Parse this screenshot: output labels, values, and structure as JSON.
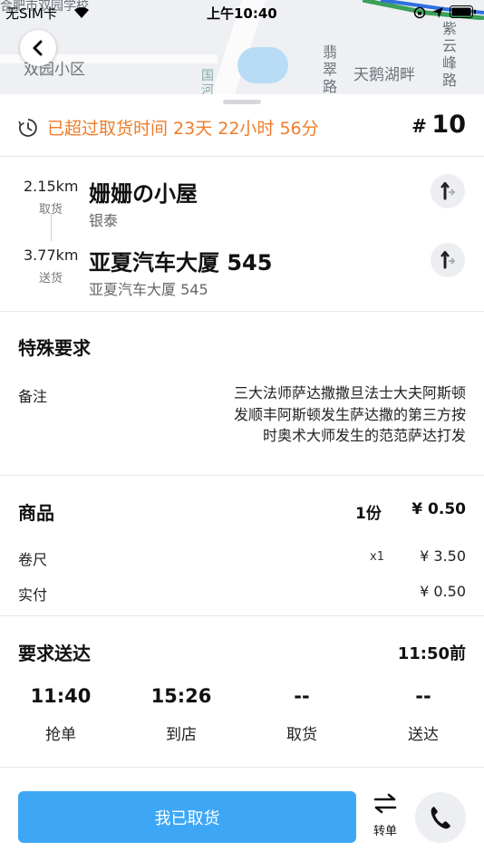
{
  "status_bar": {
    "carrier": "无SIM卡",
    "time": "上午10:40"
  },
  "map": {
    "labels": [
      "合肥市双园学校",
      "双园小区",
      "翡翠路",
      "天鹅湖畔",
      "紫云峰路",
      "国河"
    ]
  },
  "order": {
    "overdue_text": "已超过取货时间 23天 22小时 56分",
    "hash": "#",
    "number": "10",
    "accent_color": "#f07c2a"
  },
  "pickup": {
    "distance": "2.15km",
    "role": "取货",
    "name": "姗姗の小屋",
    "address": "银泰"
  },
  "dropoff": {
    "distance": "3.77km",
    "role": "送货",
    "name": "亚夏汽车大厦 545",
    "address": "亚夏汽车大厦 545"
  },
  "special": {
    "title": "特殊要求",
    "remark_label": "备注",
    "remark_text": "三大法师萨达撒撒旦法士大夫阿斯顿发顺丰阿斯顿发生萨达撒的第三方按时奥术大师发生的范范萨达打发"
  },
  "goods": {
    "title": "商品",
    "count": "1份",
    "total": "¥ 0.50",
    "items": [
      {
        "name": "卷尺",
        "qty": "x1",
        "price": "¥ 3.50"
      }
    ],
    "paid_label": "实付",
    "paid_value": "¥ 0.50"
  },
  "delivery": {
    "title": "要求送达",
    "deadline": "11:50前",
    "timeline": [
      {
        "time": "11:40",
        "label": "抢单"
      },
      {
        "time": "15:26",
        "label": "到店"
      },
      {
        "time": "--",
        "label": "取货"
      },
      {
        "time": "--",
        "label": "送达"
      }
    ]
  },
  "actions": {
    "primary_label": "我已取货",
    "primary_color": "#3da7f5",
    "transfer_label": "转单"
  },
  "icons": [
    "chevron-left-icon",
    "clock-icon",
    "navigate-icon",
    "swap-icon",
    "phone-icon"
  ]
}
